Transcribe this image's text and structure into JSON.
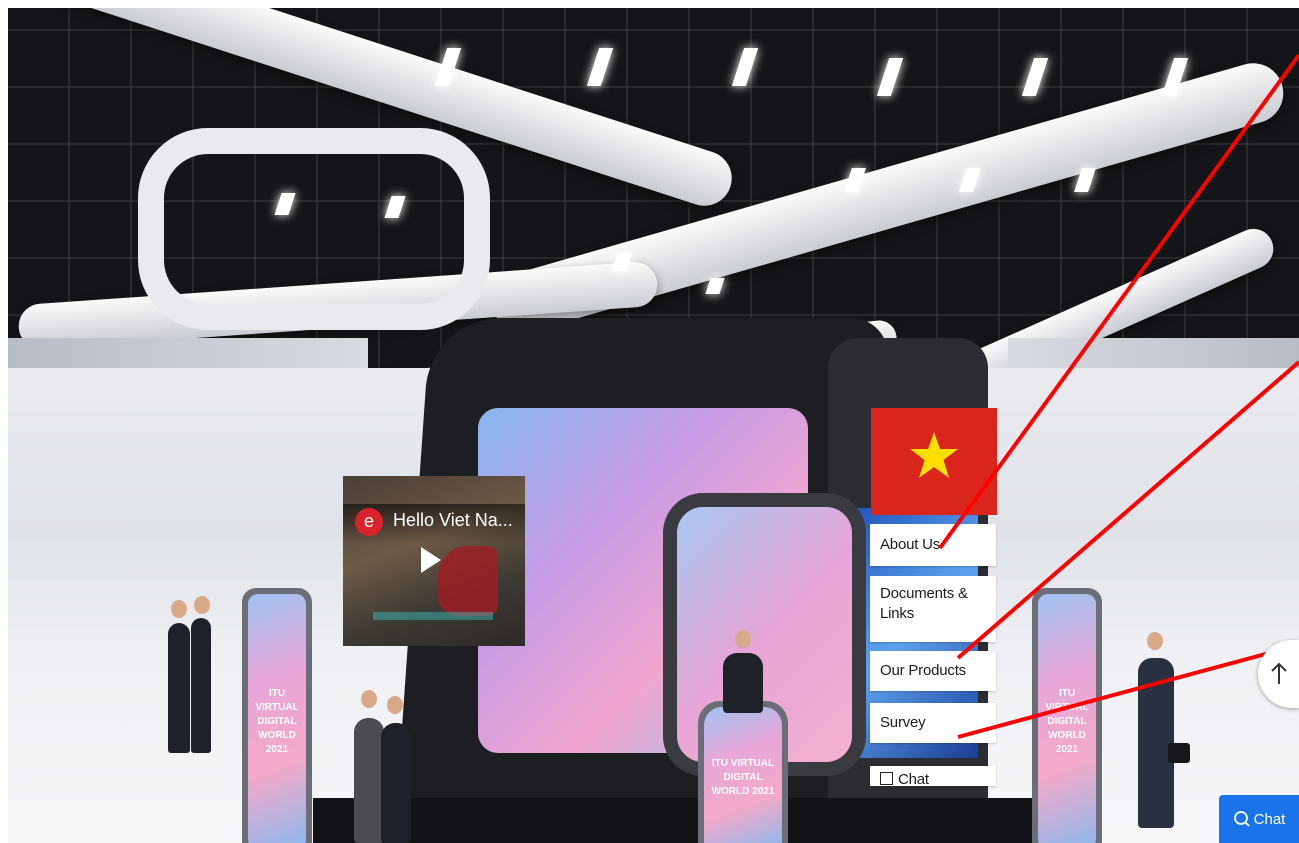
{
  "video": {
    "title": "Hello Viet Na...",
    "channel_logo": "e"
  },
  "banners": {
    "left": "ITU VIRTUAL DIGITAL WORLD 2021",
    "center": "ITU VIRTUAL DIGITAL WORLD 2021",
    "right": "ITU VIRTUAL DIGITAL WORLD 2021"
  },
  "flag": {
    "colors": {
      "field": "#da251d",
      "star": "#ffde00"
    }
  },
  "menu": {
    "about": "About Us",
    "documents": "Documents & Links",
    "products": "Our Products",
    "survey": "Survey",
    "chat": "Chat"
  },
  "chat_button": {
    "label": "Chat",
    "color": "#1a73e8"
  },
  "icons": {
    "scroll_top": "arrow-up-icon",
    "chat": "chat-bubble-icon",
    "play": "play-icon",
    "chat_checkbox": "checkbox-icon"
  },
  "annotation_color": "#ff0000"
}
